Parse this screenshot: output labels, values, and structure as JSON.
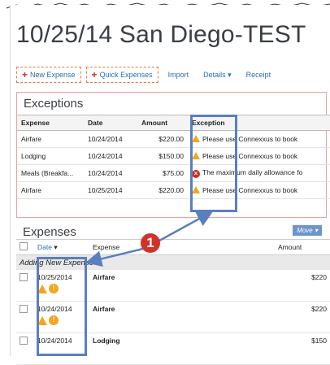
{
  "title": "10/25/14 San Diego-TEST",
  "toolbar": {
    "new_expense": "New Expense",
    "quick_expenses": "Quick Expenses",
    "import": "Import",
    "details": "Details",
    "receipts": "Receipt"
  },
  "exceptions": {
    "heading": "Exceptions",
    "columns": [
      "Expense",
      "Date",
      "Amount",
      "Exception"
    ],
    "rows": [
      {
        "expense": "Airfare",
        "date": "10/24/2014",
        "amount": "$220.00",
        "exception": "Please use Connexxus to book",
        "icon": "warning-icon"
      },
      {
        "expense": "Lodging",
        "date": "10/24/2014",
        "amount": "$150.00",
        "exception": "Please use Connexxus to book",
        "icon": "warning-icon"
      },
      {
        "expense": "Meals (Breakfa...",
        "date": "10/24/2014",
        "amount": "$75.00",
        "exception": "The maximum daily allowance fo",
        "icon": "error-icon"
      },
      {
        "expense": "Airfare",
        "date": "10/25/2014",
        "amount": "$220.00",
        "exception": "Please use Connexxus to book",
        "icon": "warning-icon"
      }
    ]
  },
  "expenses": {
    "heading": "Expenses",
    "move_label": "Move",
    "columns": [
      "Date",
      "Expense",
      "Amount"
    ],
    "adding_label": "Adding New Expense",
    "rows": [
      {
        "date": "10/25/2014",
        "type": "Airfare",
        "amount": "$220"
      },
      {
        "date": "10/24/2014",
        "type": "Airfare",
        "amount": "$220"
      },
      {
        "date": "10/24/2014",
        "type": "Lodging",
        "amount": "$150"
      }
    ]
  },
  "callout": {
    "number": "1"
  },
  "colors": {
    "accent": "#2a6db0",
    "highlight": "#5a7fbf",
    "marker": "#d1322a",
    "warning": "#f3a61e",
    "error": "#d42d1f"
  }
}
